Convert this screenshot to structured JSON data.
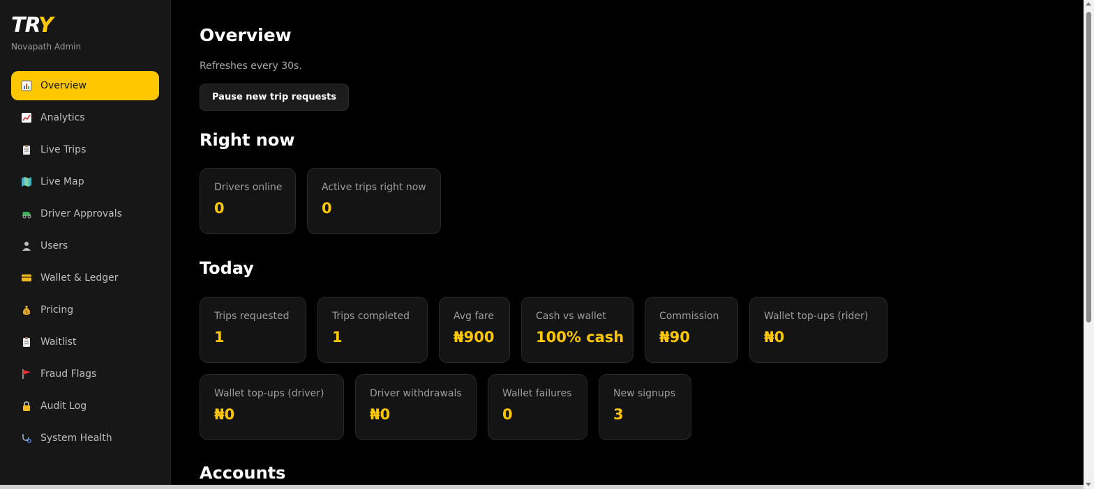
{
  "brand": {
    "logo_text": "TRY",
    "subtitle": "Novapath Admin"
  },
  "sidebar": {
    "items": [
      {
        "label": "Overview",
        "icon": "bar-chart-icon",
        "active": true
      },
      {
        "label": "Analytics",
        "icon": "trend-chart-icon",
        "active": false
      },
      {
        "label": "Live Trips",
        "icon": "clipboard-icon",
        "active": false
      },
      {
        "label": "Live Map",
        "icon": "map-icon",
        "active": false
      },
      {
        "label": "Driver Approvals",
        "icon": "auto-rickshaw-icon",
        "active": false
      },
      {
        "label": "Users",
        "icon": "user-icon",
        "active": false
      },
      {
        "label": "Wallet & Ledger",
        "icon": "card-icon",
        "active": false
      },
      {
        "label": "Pricing",
        "icon": "money-bag-icon",
        "active": false
      },
      {
        "label": "Waitlist",
        "icon": "clipboard-icon",
        "active": false
      },
      {
        "label": "Fraud Flags",
        "icon": "flag-icon",
        "active": false
      },
      {
        "label": "Audit Log",
        "icon": "lock-icon",
        "active": false
      },
      {
        "label": "System Health",
        "icon": "stethoscope-icon",
        "active": false
      }
    ]
  },
  "main": {
    "title": "Overview",
    "refresh_note": "Refreshes every 30s.",
    "pause_button": "Pause new trip requests",
    "right_now": {
      "heading": "Right now",
      "cards": [
        {
          "label": "Drivers online",
          "value": "0"
        },
        {
          "label": "Active trips right now",
          "value": "0"
        }
      ]
    },
    "today": {
      "heading": "Today",
      "row1": [
        {
          "label": "Trips requested",
          "value": "1"
        },
        {
          "label": "Trips completed",
          "value": "1"
        },
        {
          "label": "Avg fare",
          "value": "₦900"
        },
        {
          "label": "Cash vs wallet",
          "value": "100% cash"
        },
        {
          "label": "Commission",
          "value": "₦90"
        },
        {
          "label": "Wallet top-ups (rider)",
          "value": "₦0"
        }
      ],
      "row2": [
        {
          "label": "Wallet top-ups (driver)",
          "value": "₦0"
        },
        {
          "label": "Driver withdrawals",
          "value": "₦0"
        },
        {
          "label": "Wallet failures",
          "value": "0"
        },
        {
          "label": "New signups",
          "value": "3"
        }
      ]
    },
    "accounts": {
      "heading": "Accounts"
    }
  },
  "colors": {
    "accent": "#FFC700",
    "sidebar_bg": "#171717",
    "card_bg": "#141414",
    "page_bg": "#000000"
  }
}
